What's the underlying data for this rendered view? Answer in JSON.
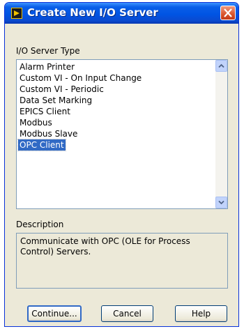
{
  "window": {
    "title": "Create New I/O Server",
    "icon": "labview-icon",
    "close_icon": "close-icon"
  },
  "server_type": {
    "label": "I/O Server Type",
    "items": [
      {
        "label": "Alarm Printer",
        "selected": false
      },
      {
        "label": "Custom VI - On Input Change",
        "selected": false
      },
      {
        "label": "Custom VI - Periodic",
        "selected": false
      },
      {
        "label": "Data Set Marking",
        "selected": false
      },
      {
        "label": "EPICS Client",
        "selected": false
      },
      {
        "label": "Modbus",
        "selected": false
      },
      {
        "label": "Modbus Slave",
        "selected": false
      },
      {
        "label": "OPC Client",
        "selected": true
      }
    ]
  },
  "description": {
    "label": "Description",
    "text": "Communicate with OPC (OLE for Process Control) Servers."
  },
  "buttons": {
    "continue": "Continue...",
    "cancel": "Cancel",
    "help": "Help"
  },
  "colors": {
    "selection": "#316ac5",
    "titlebar": "#0054e3",
    "dialog_bg": "#ece9d8"
  }
}
